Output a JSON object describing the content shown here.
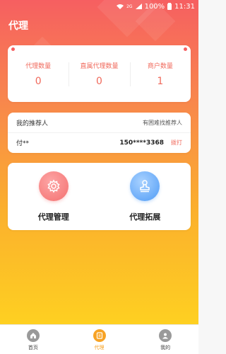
{
  "status_bar": {
    "battery": "100%",
    "time": "11:31",
    "network": "2G"
  },
  "header": {
    "title": "代理"
  },
  "stats": [
    {
      "label": "代理数量",
      "value": "0"
    },
    {
      "label": "直属代理数量",
      "value": "0"
    },
    {
      "label": "商户数量",
      "value": "1"
    }
  ],
  "referrer": {
    "title": "我的推荐人",
    "help_link": "有困难找推荐人",
    "name": "付**",
    "phone": "150****3368",
    "call_label": "拨打"
  },
  "functions": [
    {
      "label": "代理管理",
      "icon": "gear-icon"
    },
    {
      "label": "代理拓展",
      "icon": "stamp-icon"
    }
  ],
  "tabbar": [
    {
      "label": "首页",
      "icon": "home-icon",
      "active": false
    },
    {
      "label": "代理",
      "icon": "agent-icon",
      "active": true
    },
    {
      "label": "我的",
      "icon": "user-icon",
      "active": false
    }
  ],
  "colors": {
    "accent": "#f65f61",
    "gradient_top": "#f65f61",
    "gradient_bottom": "#fed021",
    "tab_active": "#f7a325",
    "stat_text": "#f06a5c"
  }
}
